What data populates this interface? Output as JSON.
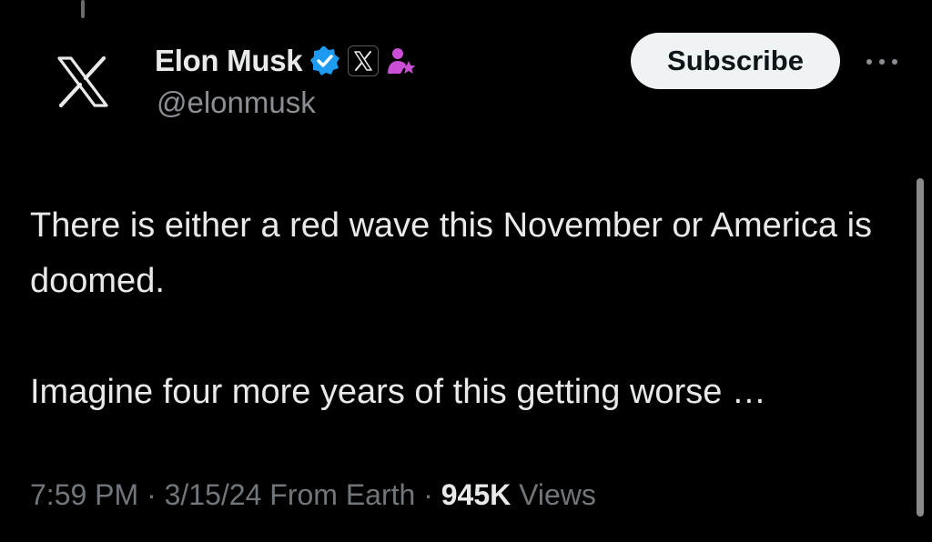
{
  "author": {
    "display_name": "Elon Musk",
    "handle": "@elonmusk",
    "avatar_icon": "x-logo-icon",
    "verified_icon": "verified-badge-icon",
    "affiliation_icon": "x-affiliate-badge-icon",
    "extra_badge_icon": "subscriber-star-icon"
  },
  "actions": {
    "subscribe_label": "Subscribe",
    "more_icon": "more-options-icon"
  },
  "tweet": {
    "paragraphs": [
      "There is either a red wave this November or America is doomed.",
      "Imagine four more years of this getting worse …"
    ],
    "time": "7:59 PM",
    "date": "3/15/24",
    "location": "From Earth",
    "separator": " · ",
    "views_count": "945K",
    "views_label": "Views"
  },
  "colors": {
    "background": "#000000",
    "primary_text": "#e7e9ea",
    "secondary_text": "#71767b",
    "verified_blue": "#1d9bf0",
    "badge_purple": "#c94fd6",
    "subscribe_bg": "#eff3f4"
  }
}
